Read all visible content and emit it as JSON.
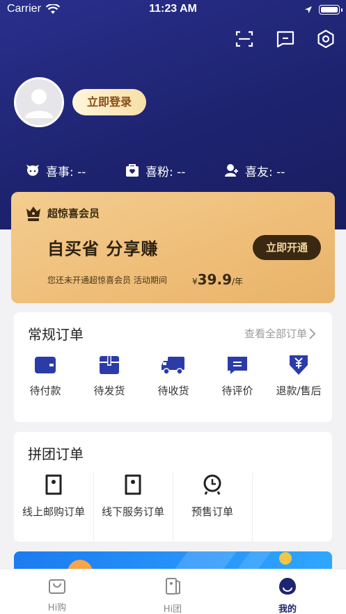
{
  "status_bar": {
    "carrier": "Carrier",
    "time": "11:23 AM"
  },
  "header": {
    "login_label": "立即登录",
    "stats": [
      {
        "label": "喜事: --",
        "icon": "happy-face-icon"
      },
      {
        "label": "喜粉: --",
        "icon": "heart-bag-icon"
      },
      {
        "label": "喜友: --",
        "icon": "friend-add-icon"
      }
    ]
  },
  "vip": {
    "title": "超惊喜会员",
    "slogan": "自买省  分享赚",
    "open_label": "立即开通",
    "desc": "您还未开通超惊喜会员 活动期间",
    "currency": "¥",
    "price": "39.9",
    "unit": "/年"
  },
  "orders": {
    "title": "常规订单",
    "view_all": "查看全部订单",
    "items": [
      {
        "label": "待付款",
        "icon": "wallet-icon"
      },
      {
        "label": "待发货",
        "icon": "package-icon"
      },
      {
        "label": "待收货",
        "icon": "truck-icon"
      },
      {
        "label": "待评价",
        "icon": "comment-icon"
      },
      {
        "label": "退款/售后",
        "icon": "refund-icon"
      }
    ]
  },
  "group_orders": {
    "title": "拼团订单",
    "items": [
      {
        "label": "线上邮购订单",
        "icon": "tag-icon"
      },
      {
        "label": "线下服务订单",
        "icon": "tag-icon"
      },
      {
        "label": "预售订单",
        "icon": "clock-icon"
      }
    ]
  },
  "tabbar": {
    "tabs": [
      {
        "label": "Hi购",
        "icon": "shopping-bag-icon"
      },
      {
        "label": "Hi团",
        "icon": "group-tag-icon"
      },
      {
        "label": "我的",
        "icon": "profile-icon"
      }
    ],
    "active": "我的"
  },
  "colors": {
    "brand": "#1f2470",
    "gold": "#eebd77",
    "icon_blue": "#2b3ca8"
  }
}
